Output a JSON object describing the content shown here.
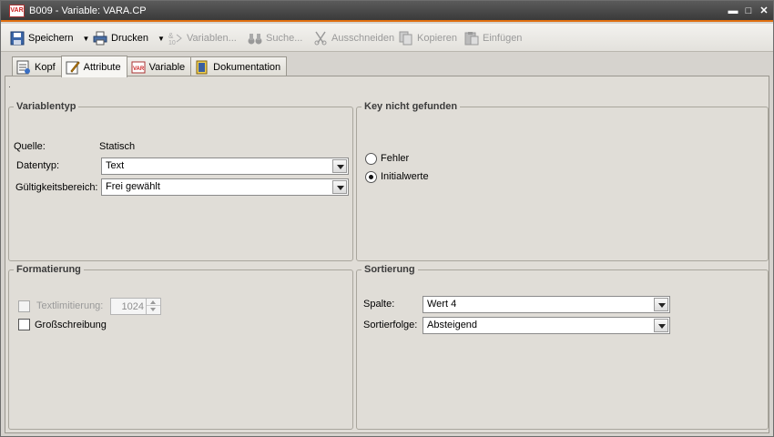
{
  "window": {
    "title": "B009 - Variable: VARA.CP",
    "icon_text": "VAR",
    "controls": [
      "minimize-icon",
      "maximize-icon",
      "close-icon"
    ]
  },
  "toolbar": {
    "save_label": "Speichern",
    "print_label": "Drucken",
    "variables_label": "Variablen...",
    "search_label": "Suche...",
    "cut_label": "Ausschneiden",
    "copy_label": "Kopieren",
    "paste_label": "Einfügen"
  },
  "tabs": [
    {
      "label": "Kopf",
      "active": false
    },
    {
      "label": "Attribute",
      "active": true
    },
    {
      "label": "Variable",
      "active": false
    },
    {
      "label": "Dokumentation",
      "active": false
    }
  ],
  "variablentyp": {
    "legend": "Variablentyp",
    "source_label": "Quelle:",
    "source_value": "Statisch",
    "datatype_label": "Datentyp:",
    "datatype_value": "Text",
    "scope_label": "Gültigkeitsbereich:",
    "scope_value": "Frei gewählt"
  },
  "key_not_found": {
    "legend": "Key nicht gefunden",
    "options": [
      {
        "label": "Fehler",
        "selected": false
      },
      {
        "label": "Initialwerte",
        "selected": true
      }
    ]
  },
  "formatierung": {
    "legend": "Formatierung",
    "textlimit_label": "Textlimitierung:",
    "textlimit_checked": false,
    "textlimit_enabled": false,
    "textlimit_value": "1024",
    "uppercase_label": "Großschreibung",
    "uppercase_checked": false
  },
  "sortierung": {
    "legend": "Sortierung",
    "column_label": "Spalte:",
    "column_value": "Wert 4",
    "order_label": "Sortierfolge:",
    "order_value": "Absteigend"
  },
  "colors": {
    "title_bg": "#3a3a3a",
    "title_accent": "#e06f10",
    "panel_bg": "#e0ddd7"
  }
}
